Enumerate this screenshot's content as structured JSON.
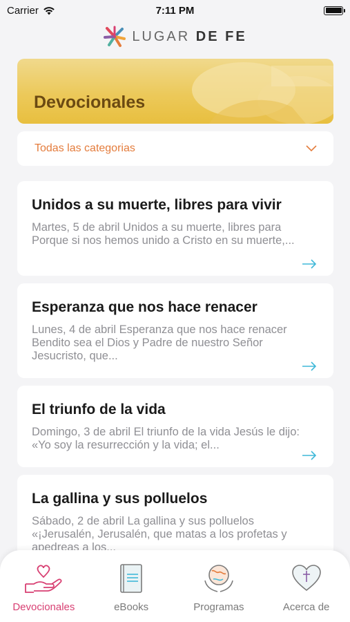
{
  "status_bar": {
    "carrier": "Carrier",
    "time": "7:11 PM"
  },
  "header": {
    "brand_light": "LUGAR",
    "brand_bold": "DE FE"
  },
  "banner": {
    "title": "Devocionales"
  },
  "category_filter": {
    "selected": "Todas las categorias"
  },
  "devotionals": [
    {
      "title": "Unidos a su muerte, libres para vivir",
      "excerpt": "Martes, 5 de abril Unidos a su muerte, libres para Porque si nos hemos unido a Cristo en su muerte,..."
    },
    {
      "title": "Esperanza que nos hace renacer",
      "excerpt": "Lunes, 4 de abril Esperanza que nos hace renacer Bendito sea el Dios y Padre de nuestro Señor Jesucristo, que..."
    },
    {
      "title": "El triunfo de la vida",
      "excerpt": "Domingo, 3 de abril El triunfo de la vida Jesús le dijo: «Yo soy la resurrección y la vida; el..."
    },
    {
      "title": "La gallina y sus polluelos",
      "excerpt": "Sábado, 2 de abril La gallina y sus polluelos «¡Jerusalén, Jerusalén, que matas a los profetas y apedreas a los..."
    }
  ],
  "tabs": [
    {
      "label": "Devocionales",
      "icon": "hand-heart-icon",
      "active": true
    },
    {
      "label": "eBooks",
      "icon": "book-icon",
      "active": false
    },
    {
      "label": "Programas",
      "icon": "globe-hands-icon",
      "active": false
    },
    {
      "label": "Acerca de",
      "icon": "heart-cross-icon",
      "active": false
    }
  ],
  "colors": {
    "accent": "#d83f72",
    "category_text": "#e47c3c",
    "arrow": "#3fb8d8",
    "banner": "#ecc95a"
  }
}
